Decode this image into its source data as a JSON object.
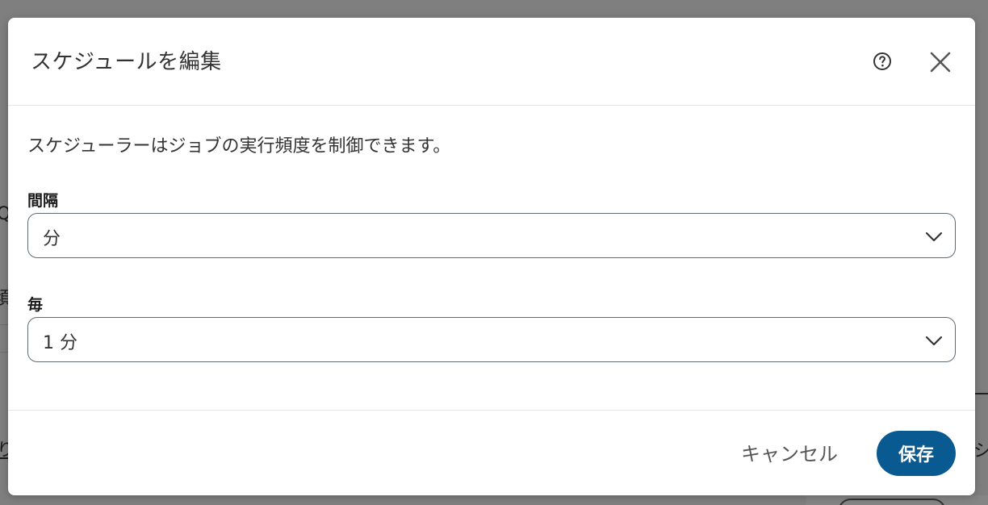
{
  "colors": {
    "overlay": "#7f7f7f",
    "primary": "#0a5a92",
    "border": "#5f6b74",
    "text": "#333333"
  },
  "background": {
    "frag_left_1": "Q",
    "frag_left_2": "頃",
    "frag_left_3": "り",
    "frag_right_1": "シ"
  },
  "modal": {
    "title": "スケジュールを編集",
    "help_icon": "question-circle-icon",
    "close_icon": "close-icon",
    "description": "スケジューラーはジョブの実行頻度を制御できます。",
    "fields": [
      {
        "label": "間隔",
        "value": "分"
      },
      {
        "label": "毎",
        "value": "1 分"
      }
    ],
    "footer": {
      "cancel_label": "キャンセル",
      "save_label": "保存"
    }
  }
}
